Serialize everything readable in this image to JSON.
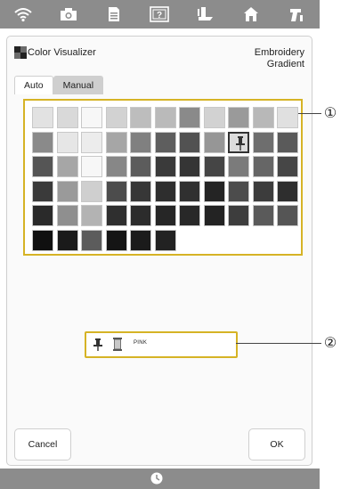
{
  "topbar": {
    "icons": [
      "wifi-icon",
      "camera-icon",
      "document-icon",
      "help-icon",
      "embroidery-foot-icon",
      "home-icon",
      "sewing-machine-icon"
    ]
  },
  "header": {
    "title": "Color Visualizer",
    "mode_line1": "Embroidery",
    "mode_line2": "Gradient"
  },
  "tabs": [
    {
      "label": "Auto"
    },
    {
      "label": "Manual"
    }
  ],
  "palette": {
    "rows": [
      [
        "#e2e2e2",
        "#d9d9d9",
        "#f7f7f7",
        "#d2d2d2",
        "#bdbdbd",
        "#bababa",
        "#8a8a8a",
        "#d2d2d2",
        "#9a9a9a",
        "#b8b8b8",
        "#e0e0e0"
      ],
      [
        "#8a8a8a",
        "#e6e6e6",
        "#ececec",
        "#a6a6a6",
        "#808080",
        "#5e5e5e",
        "#525252",
        "#969696",
        "#dcdcdc",
        "#6e6e6e",
        "#5a5a5a"
      ],
      [
        "#555555",
        "#a6a6a6",
        "#f7f7f7",
        "#878787",
        "#5c5c5c",
        "#3a3a3a",
        "#353535",
        "#454545",
        "#7b7b7b",
        "#666666",
        "#464646"
      ],
      [
        "#3a3a3a",
        "#9a9a9a",
        "#cfcfcf",
        "#4c4c4c",
        "#373737",
        "#2e2e2e",
        "#303030",
        "#242424",
        "#4c4c4c",
        "#3c3c3c",
        "#2e2e2e"
      ],
      [
        "#2a2a2a",
        "#8f8f8f",
        "#b3b3b3",
        "#2f2f2f",
        "#2c2c2c",
        "#262626",
        "#282828",
        "#232323",
        "#3d3d3d",
        "#5a5a5a",
        "#555555"
      ],
      [
        "#101010",
        "#1a1a1a",
        "#5c5c5c",
        "#151515",
        "#1b1b1b",
        "#222222"
      ]
    ],
    "selected": {
      "row": 1,
      "col": 8
    }
  },
  "info": {
    "color_name": "PINK"
  },
  "buttons": {
    "cancel": "Cancel",
    "ok": "OK"
  },
  "callouts": {
    "grid": "①",
    "info": "②"
  },
  "colors": {
    "highlight": "#d6b325",
    "topbar": "#8c8c8c"
  }
}
